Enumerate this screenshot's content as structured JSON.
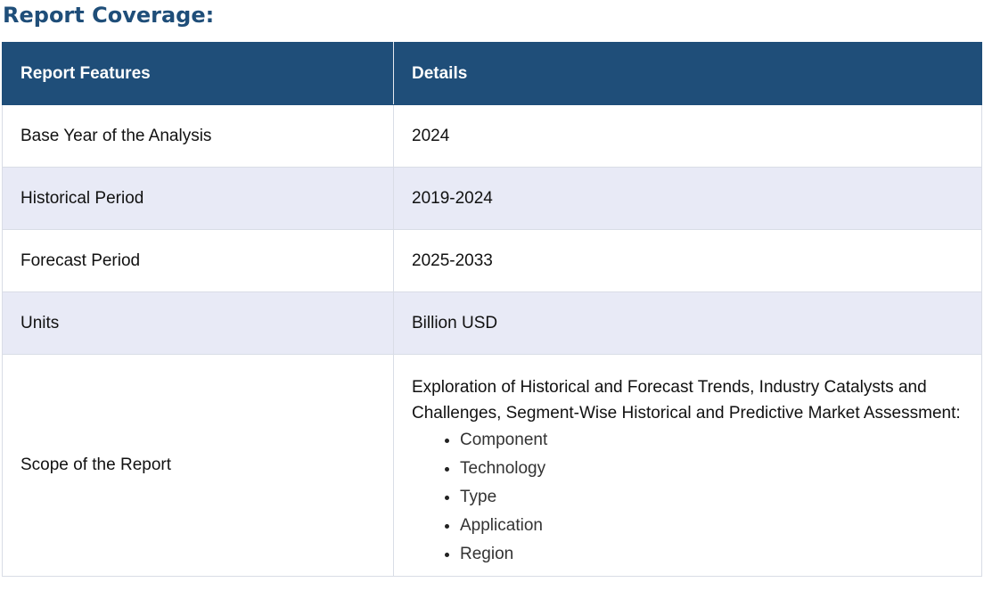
{
  "heading": "Report Coverage:",
  "table": {
    "headers": [
      "Report Features",
      "Details"
    ],
    "rows": [
      {
        "feature": "Base Year of the Analysis",
        "detail": "2024"
      },
      {
        "feature": "Historical Period",
        "detail": "2019-2024"
      },
      {
        "feature": "Forecast Period",
        "detail": "2025-2033"
      },
      {
        "feature": "Units",
        "detail": "Billion USD"
      }
    ],
    "scope": {
      "feature": "Scope of the Report",
      "text": "Exploration of Historical and Forecast Trends, Industry Catalysts and Challenges, Segment-Wise Historical and Predictive Market Assessment:",
      "items": [
        "Component",
        "Technology",
        "Type",
        "Application",
        "Region"
      ]
    }
  },
  "colors": {
    "header_bg": "#1f4e79",
    "heading_text": "#1f4e79",
    "alt_row_bg": "#e8eaf6"
  }
}
